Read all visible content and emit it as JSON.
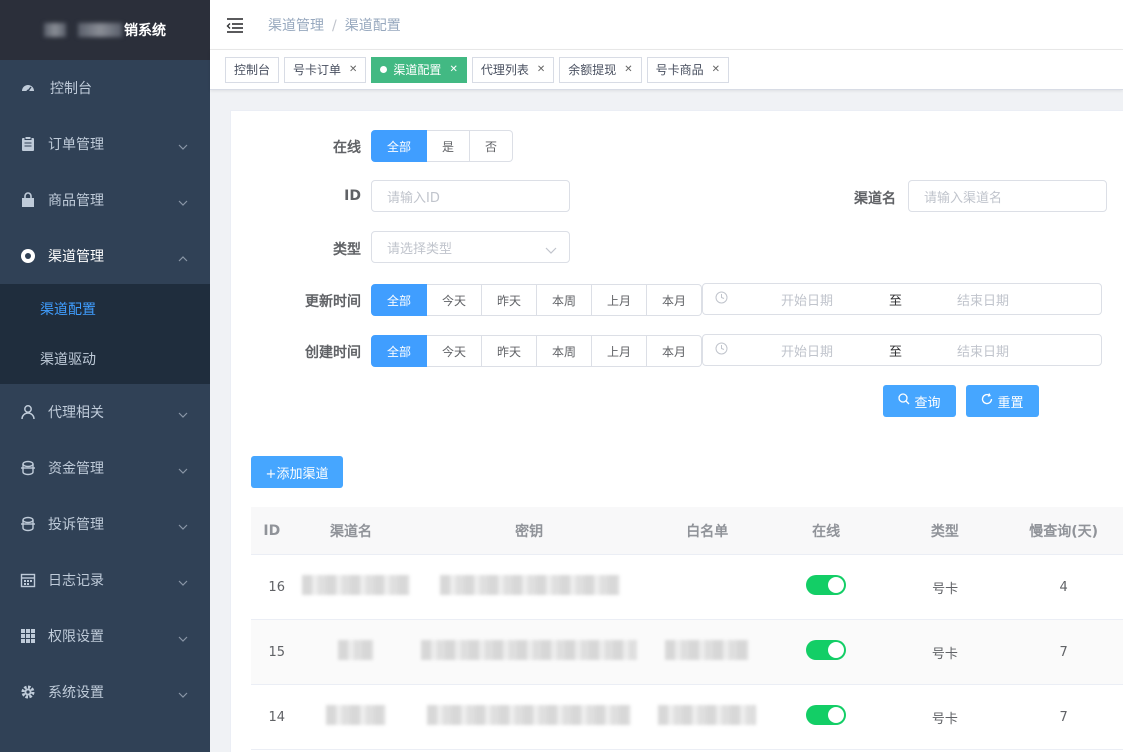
{
  "app": {
    "title_suffix": "销系统"
  },
  "sidebar": {
    "items": [
      {
        "label": "控制台",
        "icon": "dashboard-icon"
      },
      {
        "label": "订单管理",
        "icon": "clipboard-icon"
      },
      {
        "label": "商品管理",
        "icon": "bag-icon"
      },
      {
        "label": "渠道管理",
        "icon": "channel-icon"
      },
      {
        "label": "代理相关",
        "icon": "user-icon"
      },
      {
        "label": "资金管理",
        "icon": "wallet-icon"
      },
      {
        "label": "投诉管理",
        "icon": "complaint-icon"
      },
      {
        "label": "日志记录",
        "icon": "calendar-icon"
      },
      {
        "label": "权限设置",
        "icon": "grid-icon"
      },
      {
        "label": "系统设置",
        "icon": "gear-icon"
      }
    ],
    "sub_items": [
      {
        "label": "渠道配置"
      },
      {
        "label": "渠道驱动"
      }
    ]
  },
  "breadcrumb": {
    "parent": "渠道管理",
    "sep": "/",
    "current": "渠道配置"
  },
  "tags": [
    {
      "label": "控制台"
    },
    {
      "label": "号卡订单"
    },
    {
      "label": "渠道配置"
    },
    {
      "label": "代理列表"
    },
    {
      "label": "余额提现"
    },
    {
      "label": "号卡商品"
    }
  ],
  "filters": {
    "online": {
      "label": "在线",
      "options": [
        "全部",
        "是",
        "否"
      ]
    },
    "id": {
      "label": "ID",
      "placeholder": "请输入ID"
    },
    "name": {
      "label": "渠道名",
      "placeholder": "请输入渠道名"
    },
    "type": {
      "label": "类型",
      "placeholder": "请选择类型"
    },
    "updated": {
      "label": "更新时间",
      "options": [
        "全部",
        "今天",
        "昨天",
        "本周",
        "上月",
        "本月"
      ],
      "start": "开始日期",
      "to": "至",
      "end": "结束日期"
    },
    "created": {
      "label": "创建时间",
      "options": [
        "全部",
        "今天",
        "昨天",
        "本周",
        "上月",
        "本月"
      ],
      "start": "开始日期",
      "to": "至",
      "end": "结束日期"
    },
    "query_label": "查询",
    "reset_label": "重置"
  },
  "add_button": "+添加渠道",
  "table": {
    "headers": [
      "ID",
      "渠道名",
      "密钥",
      "白名单",
      "在线",
      "类型",
      "慢查询(天)"
    ],
    "rows": [
      {
        "id": "16",
        "online": true,
        "type": "号卡",
        "slow": "4"
      },
      {
        "id": "15",
        "online": true,
        "type": "号卡",
        "slow": "7"
      },
      {
        "id": "14",
        "online": true,
        "type": "号卡",
        "slow": "7"
      }
    ]
  },
  "colors": {
    "primary": "#409eff",
    "active_tag": "#42b983",
    "switch_on": "#13ce66",
    "sidebar_bg": "#304156"
  }
}
